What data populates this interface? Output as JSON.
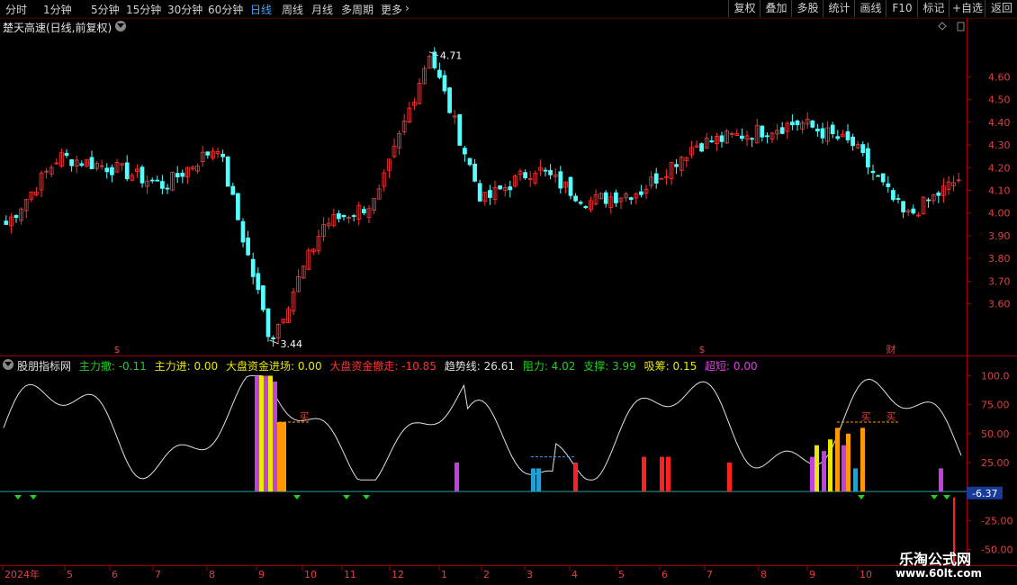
{
  "toolbar": {
    "periods": [
      "分时",
      "1分钟",
      "5分钟",
      "15分钟",
      "30分钟",
      "60分钟",
      "日线",
      "周线",
      "月线",
      "多周期",
      "更多"
    ],
    "active_period": "日线",
    "right_buttons": [
      "复权",
      "叠加",
      "多股",
      "统计",
      "画线",
      "F10",
      "标记",
      "+自选",
      "返回"
    ]
  },
  "main_chart": {
    "title": "楚天高速(日线,前复权)",
    "high_label": "4.71",
    "low_label": "3.44",
    "price_axis": [
      "4.60",
      "4.50",
      "4.40",
      "4.30",
      "4.20",
      "4.10",
      "4.00",
      "3.90",
      "3.80",
      "3.70",
      "3.60"
    ],
    "markers": [
      "$",
      "$",
      "财"
    ]
  },
  "indicator": {
    "name": "股朋指标网",
    "legend": [
      {
        "label": "主力撤: -0.11",
        "color": "#22d022"
      },
      {
        "label": "主力进: 0.00",
        "color": "#e8e800"
      },
      {
        "label": "大盘资金进场: 0.00",
        "color": "#e8e800"
      },
      {
        "label": "大盘资金撤走: -10.85",
        "color": "#ff3030"
      },
      {
        "label": "趋势线: 26.61",
        "color": "#e0e0e0"
      },
      {
        "label": "阻力: 4.02",
        "color": "#22d022"
      },
      {
        "label": "支撑: 3.99",
        "color": "#22d022"
      },
      {
        "label": "吸筹: 0.15",
        "color": "#e8e800"
      },
      {
        "label": "超短: 0.00",
        "color": "#e040e0"
      }
    ],
    "axis": [
      "100.0",
      "75.00",
      "50.00",
      "25.00",
      "-25.00",
      "-50.00"
    ],
    "current_value": "-6.37",
    "buy_labels": [
      "买",
      "买",
      "买"
    ]
  },
  "time_axis": [
    "2024年",
    "5",
    "6",
    "7",
    "8",
    "9",
    "10",
    "11",
    "12",
    "1",
    "2",
    "3",
    "4",
    "5",
    "6",
    "7",
    "8",
    "9",
    "10"
  ],
  "watermark": {
    "line1": "乐淘公式网",
    "line2": "www.60lt.com"
  },
  "chart_data": {
    "type": "candlestick",
    "title": "楚天高速(日线,前复权)",
    "price_axis_range": [
      3.44,
      4.71
    ],
    "points": [
      {
        "month": "2024-04",
        "close": 3.95
      },
      {
        "month": "2024-05",
        "close": 4.25
      },
      {
        "month": "2024-06",
        "close": 4.2
      },
      {
        "month": "2024-07",
        "close": 4.12
      },
      {
        "month": "2024-08",
        "close": 4.3
      },
      {
        "month": "2024-09",
        "close": 3.44
      },
      {
        "month": "2024-10",
        "close": 3.95
      },
      {
        "month": "2024-11",
        "close": 4.05
      },
      {
        "month": "2024-12",
        "close": 4.71
      },
      {
        "month": "2025-01",
        "close": 4.05
      },
      {
        "month": "2025-02",
        "close": 4.2
      },
      {
        "month": "2025-03",
        "close": 4.05
      },
      {
        "month": "2025-04",
        "close": 4.1
      },
      {
        "month": "2025-05",
        "close": 4.3
      },
      {
        "month": "2025-06",
        "close": 4.35
      },
      {
        "month": "2025-07",
        "close": 4.4
      },
      {
        "month": "2025-08",
        "close": 4.3
      },
      {
        "month": "2025-09",
        "close": 3.98
      },
      {
        "month": "2025-10",
        "close": 4.15
      }
    ],
    "indicator_range": [
      -62,
      112
    ]
  }
}
